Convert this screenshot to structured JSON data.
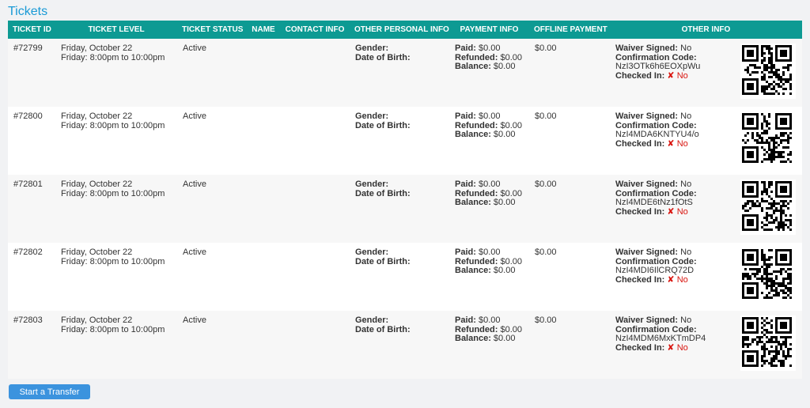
{
  "title": "Tickets",
  "columns": [
    "TICKET ID",
    "TICKET LEVEL",
    "TICKET STATUS",
    "NAME",
    "CONTACT INFO",
    "OTHER PERSONAL INFO",
    "PAYMENT INFO",
    "OFFLINE PAYMENT",
    "OTHER INFO"
  ],
  "labels": {
    "gender": "Gender:",
    "dob": "Date of Birth:",
    "paid": "Paid:",
    "refunded": "Refunded:",
    "balance": "Balance:",
    "waiver": "Waiver Signed:",
    "confirmation": "Confirmation Code:",
    "checked_in": "Checked In:"
  },
  "tickets": [
    {
      "id": "#72799",
      "level_line1": "Friday, October 22",
      "level_line2": "Friday: 8:00pm to 10:00pm",
      "status": "Active",
      "paid": "$0.00",
      "refunded": "$0.00",
      "balance": "$0.00",
      "offline": "$0.00",
      "waiver": "No",
      "code": "NzI3OTk6h6EOXpWu",
      "checked_in": "✘ No"
    },
    {
      "id": "#72800",
      "level_line1": "Friday, October 22",
      "level_line2": "Friday: 8:00pm to 10:00pm",
      "status": "Active",
      "paid": "$0.00",
      "refunded": "$0.00",
      "balance": "$0.00",
      "offline": "$0.00",
      "waiver": "No",
      "code": "NzI4MDA6KNTYU4/o",
      "checked_in": "✘ No"
    },
    {
      "id": "#72801",
      "level_line1": "Friday, October 22",
      "level_line2": "Friday: 8:00pm to 10:00pm",
      "status": "Active",
      "paid": "$0.00",
      "refunded": "$0.00",
      "balance": "$0.00",
      "offline": "$0.00",
      "waiver": "No",
      "code": "NzI4MDE6tNz1fOtS",
      "checked_in": "✘ No"
    },
    {
      "id": "#72802",
      "level_line1": "Friday, October 22",
      "level_line2": "Friday: 8:00pm to 10:00pm",
      "status": "Active",
      "paid": "$0.00",
      "refunded": "$0.00",
      "balance": "$0.00",
      "offline": "$0.00",
      "waiver": "No",
      "code": "NzI4MDI6IlCRQ72D",
      "checked_in": "✘ No"
    },
    {
      "id": "#72803",
      "level_line1": "Friday, October 22",
      "level_line2": "Friday: 8:00pm to 10:00pm",
      "status": "Active",
      "paid": "$0.00",
      "refunded": "$0.00",
      "balance": "$0.00",
      "offline": "$0.00",
      "waiver": "No",
      "code": "NzI4MDM6MxKTmDP4",
      "checked_in": "✘ No"
    }
  ],
  "transfer_button": "Start a Transfer",
  "colors": {
    "header": "#0d9a93",
    "title": "#1a9ad6",
    "button": "#3b93de",
    "no": "#d9150f"
  }
}
